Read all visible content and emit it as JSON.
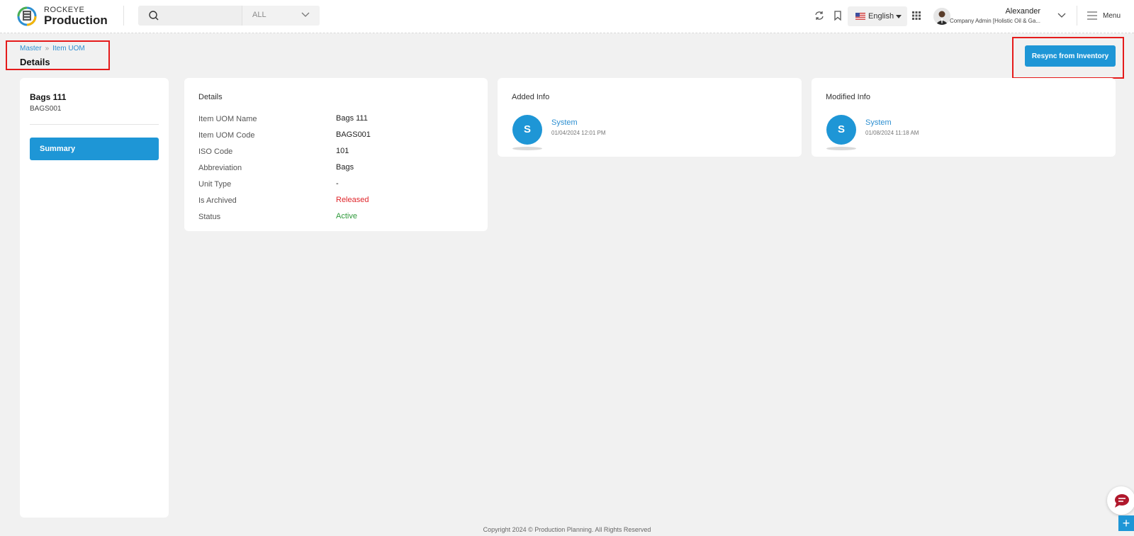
{
  "header": {
    "brand_top": "ROCKEYE",
    "brand_bottom": "Production",
    "search": {
      "value": "",
      "placeholder": "",
      "scope": "ALL"
    },
    "language": "English",
    "user": {
      "name": "Alexander",
      "role": "Company Admin [Holistic Oil & Ga..."
    },
    "menu_label": "Menu",
    "icons": [
      "refresh-icon",
      "bookmark-icon",
      "apps-grid-icon",
      "hamburger-icon",
      "us-flag-icon"
    ]
  },
  "breadcrumb": {
    "items": [
      "Master",
      "Item UOM"
    ],
    "separator": "»"
  },
  "page_title": "Details",
  "resync_label": "Resync from Inventory",
  "left_panel": {
    "title": "Bags 111",
    "code": "BAGS001",
    "summary_label": "Summary"
  },
  "details": {
    "title": "Details",
    "rows": [
      {
        "label": "Item UOM Name",
        "value": "Bags 111"
      },
      {
        "label": "Item UOM Code",
        "value": "BAGS001"
      },
      {
        "label": "ISO Code",
        "value": "101"
      },
      {
        "label": "Abbreviation",
        "value": "Bags"
      },
      {
        "label": "Unit Type",
        "value": "-"
      },
      {
        "label": "Is Archived",
        "value": "Released"
      },
      {
        "label": "Status",
        "value": "Active"
      }
    ]
  },
  "added_info": {
    "title": "Added Info",
    "initial": "S",
    "name": "System",
    "date": "01/04/2024 12:01 PM"
  },
  "modified_info": {
    "title": "Modified Info",
    "initial": "S",
    "name": "System",
    "date": "01/08/2024 11:18 AM"
  },
  "footer": "Copyright 2024 © Production Planning. All Rights Reserved",
  "colors": {
    "accent": "#1e96d6",
    "archived": "#e0262b",
    "active": "#2f9a3b",
    "highlight": "#e51b1b"
  }
}
